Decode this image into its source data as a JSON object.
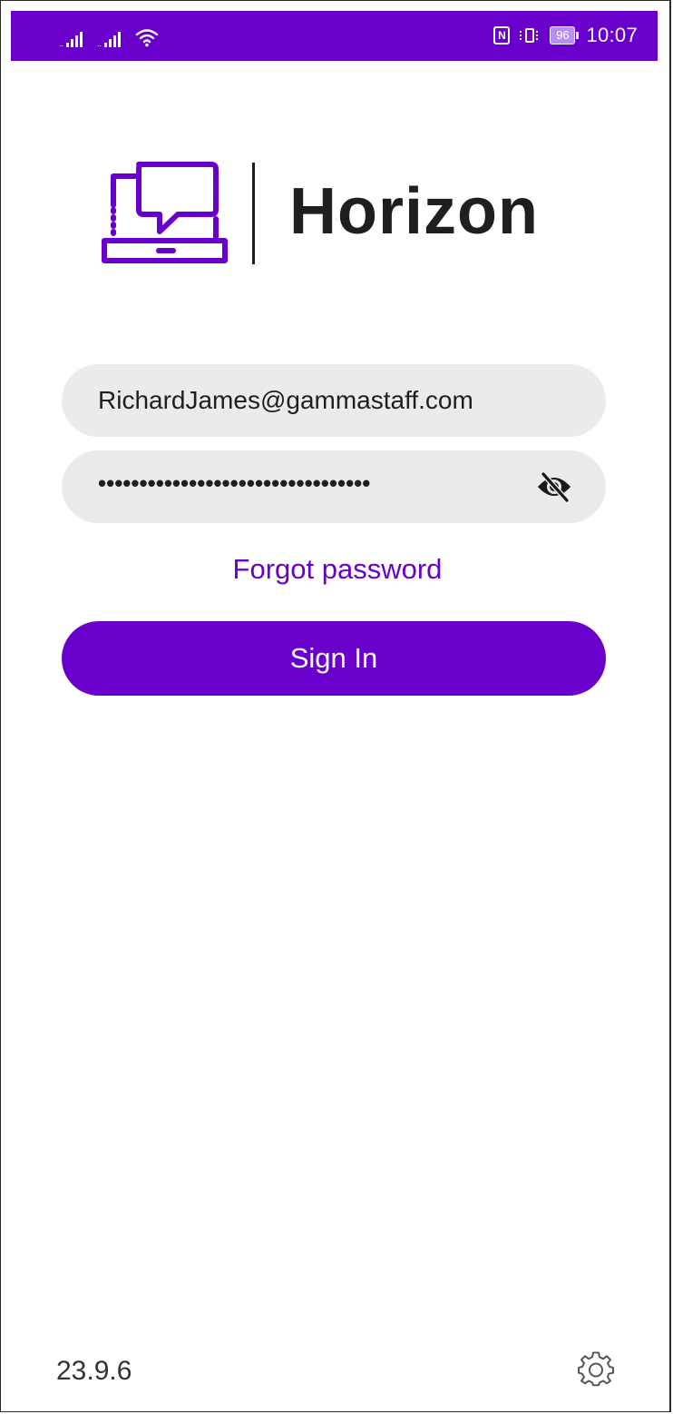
{
  "status_bar": {
    "time": "10:07",
    "battery_level": "96",
    "nfc_label": "N",
    "signal_sub": "..",
    "icons": [
      "signal-icon",
      "signal-icon",
      "wifi-icon",
      "nfc-icon",
      "vibrate-icon",
      "battery-icon"
    ],
    "background": "#6a00cc"
  },
  "brand": {
    "name": "Horizon",
    "accent": "#6a00cc",
    "logo_icon": "laptop-chat-icon"
  },
  "login": {
    "email_value": "RichardJames@gammastaff.com",
    "password_value": "•••••••••••••••••••••••••••••••••",
    "password_toggle_icon": "eye-off-icon",
    "forgot_label": "Forgot password",
    "signin_label": "Sign In"
  },
  "footer": {
    "version": "23.9.6",
    "settings_icon": "gear-icon"
  }
}
